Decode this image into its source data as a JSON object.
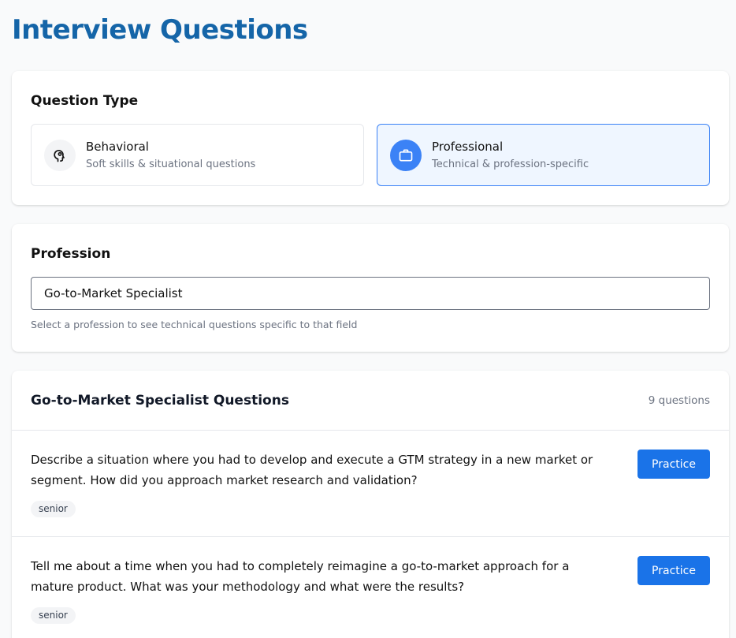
{
  "page": {
    "title": "Interview Questions"
  },
  "question_type": {
    "heading": "Question Type",
    "options": [
      {
        "label": "Behavioral",
        "sub": "Soft skills & situational questions",
        "icon": "head-icon",
        "selected": false
      },
      {
        "label": "Professional",
        "sub": "Technical & profession-specific",
        "icon": "briefcase-icon",
        "selected": true
      }
    ]
  },
  "profession": {
    "heading": "Profession",
    "value": "Go-to-Market Specialist",
    "helper": "Select a profession to see technical questions specific to that field"
  },
  "questions": {
    "title": "Go-to-Market Specialist Questions",
    "count": "9 questions",
    "items": [
      {
        "text": "Describe a situation where you had to develop and execute a GTM strategy in a new market or segment. How did you approach market research and validation?",
        "level": "senior",
        "action": "Practice"
      },
      {
        "text": "Tell me about a time when you had to completely reimagine a go-to-market approach for a mature product. What was your methodology and what were the results?",
        "level": "senior",
        "action": "Practice"
      }
    ]
  },
  "colors": {
    "accent": "#1a73e8",
    "title": "#1565a8",
    "selected_bg": "#eff6ff",
    "selected_border": "#3b82f6"
  }
}
